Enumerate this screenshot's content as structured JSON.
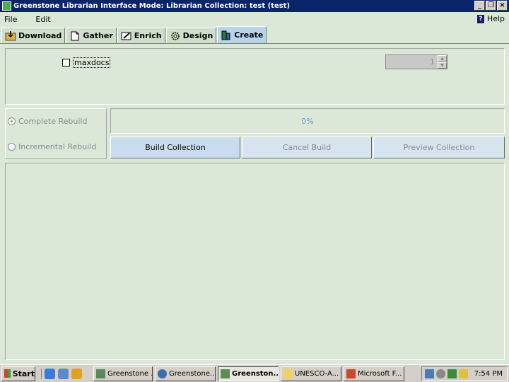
{
  "window": {
    "title": "Greenstone Librarian Interface  Mode: Librarian  Collection: test (test)",
    "minimize_glyph": "_",
    "restore_glyph": "❐",
    "close_glyph": "×"
  },
  "menubar": {
    "file": "File",
    "edit": "Edit",
    "help": "Help",
    "help_icon_glyph": "?"
  },
  "tabs": [
    {
      "label": "Download",
      "icon": "download-icon",
      "active": false
    },
    {
      "label": "Gather",
      "icon": "gather-icon",
      "active": false
    },
    {
      "label": "Enrich",
      "icon": "enrich-icon",
      "active": false
    },
    {
      "label": "Design",
      "icon": "design-icon",
      "active": false
    },
    {
      "label": "Create",
      "icon": "create-icon",
      "active": true
    }
  ],
  "options": {
    "maxdocs_label": "maxdocs",
    "maxdocs_checked": false,
    "maxdocs_value": "1"
  },
  "build_mode": {
    "complete_label": "Complete Rebuild",
    "incremental_label": "Incremental Rebuild",
    "selected": "complete"
  },
  "progress": {
    "text": "0%",
    "fraction": 0
  },
  "buttons": {
    "build": "Build Collection",
    "cancel": "Cancel Build",
    "preview": "Preview Collection"
  },
  "taskbar": {
    "start": "Start",
    "tasks": [
      {
        "label": "Greenstone ...",
        "active": false
      },
      {
        "label": "Greenstone...",
        "active": false
      },
      {
        "label": "Greenston...",
        "active": true
      },
      {
        "label": "UNESCO-A...",
        "active": false
      },
      {
        "label": "Microsoft F...",
        "active": false
      }
    ],
    "clock": "7:54 PM"
  },
  "colors": {
    "title_bar": "#0a246a",
    "panel_bg": "#dbe8d8",
    "active_tab": "#b9d3ea",
    "button_bg": "#c9dcef"
  }
}
